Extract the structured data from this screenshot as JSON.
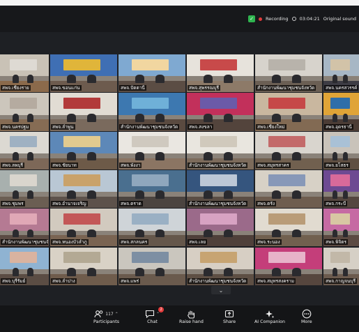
{
  "status": {
    "shield_icon": "shield-check-icon",
    "recording_label": "Recording",
    "timer": "03:04:21",
    "audio_label": "Original sound"
  },
  "gallery": {
    "tiles": [
      {
        "name": "สพจ.เชียงราย",
        "wall": "#c9c2b6",
        "banner": "#dedad3",
        "desk": "#8b6a4b"
      },
      {
        "name": "สพจ.ขอนแก่น",
        "wall": "#3f6fb4",
        "banner": "#e0b53a",
        "desk": "#6d5b4e"
      },
      {
        "name": "สพจ.ปัตตานี",
        "wall": "#7fa9d1",
        "banner": "#f1d6a0",
        "desk": "#5b4d44"
      },
      {
        "name": "สพจ.สุพรรณบุรี",
        "wall": "#e7e3dc",
        "banner": "#c84a4a",
        "desk": "#8d7a68"
      },
      {
        "name": "สำนักงานพัฒนาชุมชนจังหวัด",
        "wall": "#d7d3cc",
        "banner": "#b8b3ab",
        "desk": "#6b5f54"
      },
      {
        "name": "สพจ.นครสวรรค์",
        "wall": "#a7b7c5",
        "banner": "#d2c3a8",
        "desk": "#3d3c44"
      },
      {
        "name": "สพจ.นครปฐม",
        "wall": "#ccc6bc",
        "banner": "#b5aba0",
        "desk": "#866c54"
      },
      {
        "name": "สพจ.ลำพูน",
        "wall": "#e1dcd3",
        "banner": "#b23a3a",
        "desk": "#7a6a5d"
      },
      {
        "name": "สำนักงานพัฒนาชุมชนจังหวัด",
        "wall": "#3d78b0",
        "banner": "#6fb0d8",
        "desk": "#5a4a40"
      },
      {
        "name": "สพจ.สงขลา",
        "wall": "#c2305b",
        "banner": "#6b5aa8",
        "desk": "#53443c"
      },
      {
        "name": "สพจ.เชียงใหม่",
        "wall": "#c9b79f",
        "banner": "#c64848",
        "desk": "#826a53"
      },
      {
        "name": "สพจ.อุดรธานี",
        "wall": "#e0a437",
        "banner": "#2f6ea9",
        "desk": "#4b3c35"
      },
      {
        "name": "สพจ.ลพบุรี",
        "wall": "#dcd9d2",
        "banner": "#9fb1c2",
        "desk": "#7d6858"
      },
      {
        "name": "สพจ.ชัยนาท",
        "wall": "#5d88b8",
        "banner": "#e1ca8f",
        "desk": "#6d5a48"
      },
      {
        "name": "สพจ.พังงา",
        "wall": "#eae7e1",
        "banner": "#cfc9bf",
        "desk": "#8b7563"
      },
      {
        "name": "สำนักงานพัฒนาชุมชนจังหวัด",
        "wall": "#e9e6df",
        "banner": "#d0c9bc",
        "desk": "#7c6b5b"
      },
      {
        "name": "สพจ.สมุทรสาคร",
        "wall": "#d9d5ce",
        "banner": "#c36a6a",
        "desk": "#71604f"
      },
      {
        "name": "สพจ.ยโสธร",
        "wall": "#c9c3ba",
        "banner": "#a9c1d6",
        "desk": "#5f4f42"
      },
      {
        "name": "สพจ.ชุมพร",
        "wall": "#a8b0ae",
        "banner": "#d9d5cd",
        "desk": "#6b5e53"
      },
      {
        "name": "สพจ.อำนาจเจริญ",
        "wall": "#b9c7d4",
        "banner": "#c9a26a",
        "desk": "#5d524b"
      },
      {
        "name": "สพจ.ตราด",
        "wall": "#4a6f8f",
        "banner": "#8fa7bd",
        "desk": "#4b4440"
      },
      {
        "name": "สำนักงานพัฒนาชุมชนจังหวัด",
        "wall": "#35557e",
        "banner": "#bcc7d6",
        "desk": "#5a4d44"
      },
      {
        "name": "สพจ.ตรัง",
        "wall": "#d7d1c6",
        "banner": "#8798b8",
        "desk": "#6e5d4f"
      },
      {
        "name": "สพจ.กระบี่",
        "wall": "#6d4a92",
        "banner": "#d86a9a",
        "desk": "#54463f"
      },
      {
        "name": "สำนักงานพัฒนาชุมชนจังหวัด",
        "wall": "#b57a93",
        "banner": "#e0a8b6",
        "desk": "#5c4c44"
      },
      {
        "name": "สพจ.หนองบัวลำภู",
        "wall": "#d2cabf",
        "banner": "#c35757",
        "desk": "#7a6452"
      },
      {
        "name": "สพจ.สกลนคร",
        "wall": "#cfd4d8",
        "banner": "#9ab0c4",
        "desk": "#65574b"
      },
      {
        "name": "สพจ.เลย",
        "wall": "#9b6a8a",
        "banner": "#d7a2c2",
        "desk": "#4f403a"
      },
      {
        "name": "สพจ.ระนอง",
        "wall": "#e1dbd0",
        "banner": "#b99c78",
        "desk": "#71604f"
      },
      {
        "name": "สพจ.พิจิตร",
        "wall": "#c66aa3",
        "banner": "#d8c7a3",
        "desk": "#5c4a42"
      },
      {
        "name": "สพจ.บุรีรัมย์",
        "wall": "#8fb3d2",
        "banner": "#d9b3a0",
        "desk": "#5b4d44"
      },
      {
        "name": "สพจ.ลำปาง",
        "wall": "#d9d2c6",
        "banner": "#b3a994",
        "desk": "#6f5c4c"
      },
      {
        "name": "สพจ.แพร่",
        "wall": "#cac6be",
        "banner": "#7d8fa3",
        "desk": "#6a5a4d"
      },
      {
        "name": "สำนักงานพัฒนาชุมชนจังหวัด",
        "wall": "#d7cfc4",
        "banner": "#c7a472",
        "desk": "#5e4f44"
      },
      {
        "name": "สพจ.สมุทรสงคราม",
        "wall": "#c43e7a",
        "banner": "#e7b3c9",
        "desk": "#56463e"
      },
      {
        "name": "สพจ.กาญจนบุรี",
        "wall": "#d6d0c6",
        "banner": "#c2b8a8",
        "desk": "#6c5b4e"
      }
    ]
  },
  "toolbar": {
    "participants_label": "Participants",
    "participants_count": "117",
    "participants_icon": "participants-icon",
    "chat_label": "Chat",
    "chat_badge": "2",
    "chat_icon": "chat-icon",
    "raise_hand_label": "Raise hand",
    "raise_hand_icon": "raise-hand-icon",
    "share_label": "Share",
    "share_icon": "share-icon",
    "ai_label": "AI Companion",
    "ai_icon": "sparkle-icon",
    "more_label": "More",
    "more_icon": "more-icon",
    "caret_icon": "chevron-down-icon"
  }
}
